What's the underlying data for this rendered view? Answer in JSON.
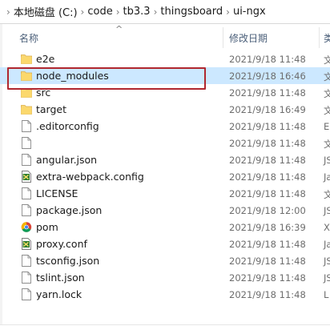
{
  "breadcrumb": [
    "本地磁盘 (C:)",
    "code",
    "tb3.3",
    "thingsboard",
    "ui-ngx"
  ],
  "breadcrumb_separator": "›",
  "headers": {
    "name": "名称",
    "modified": "修改日期",
    "type": "类"
  },
  "files": [
    {
      "name": "e2e",
      "modified": "2021/9/18 11:48",
      "type": "文",
      "icon": "folder-icon"
    },
    {
      "name": "node_modules",
      "modified": "2021/9/18 16:46",
      "type": "文",
      "icon": "folder-icon",
      "selected": true
    },
    {
      "name": "src",
      "modified": "2021/9/18 11:48",
      "type": "文",
      "icon": "folder-icon"
    },
    {
      "name": "target",
      "modified": "2021/9/18 16:49",
      "type": "文",
      "icon": "folder-icon"
    },
    {
      "name": ".editorconfig",
      "modified": "2021/9/18 11:48",
      "type": "E",
      "icon": "file-icon"
    },
    {
      "name": "",
      "modified": "2021/9/18 11:48",
      "type": "文",
      "icon": "file-icon"
    },
    {
      "name": "angular.json",
      "modified": "2021/9/18 11:48",
      "type": "JS",
      "icon": "file-icon"
    },
    {
      "name": "extra-webpack.config",
      "modified": "2021/9/18 11:48",
      "type": "Ja",
      "icon": "script-file-icon"
    },
    {
      "name": "LICENSE",
      "modified": "2021/9/18 11:48",
      "type": "文",
      "icon": "file-icon"
    },
    {
      "name": "package.json",
      "modified": "2021/9/18 12:00",
      "type": "JS",
      "icon": "file-icon"
    },
    {
      "name": "pom",
      "modified": "2021/9/18 16:39",
      "type": "X",
      "icon": "chrome-file-icon"
    },
    {
      "name": "proxy.conf",
      "modified": "2021/9/18 11:48",
      "type": "Ja",
      "icon": "script-file-icon"
    },
    {
      "name": "tsconfig.json",
      "modified": "2021/9/18 11:48",
      "type": "JS",
      "icon": "file-icon"
    },
    {
      "name": "tslint.json",
      "modified": "2021/9/18 11:48",
      "type": "JS",
      "icon": "file-icon"
    },
    {
      "name": "yarn.lock",
      "modified": "2021/9/18 11:48",
      "type": "L",
      "icon": "file-icon"
    }
  ],
  "colors": {
    "selection": "#cce8ff",
    "highlight_border": "#b0272f",
    "folder": "#f8d775",
    "header_text": "#4c607a"
  }
}
